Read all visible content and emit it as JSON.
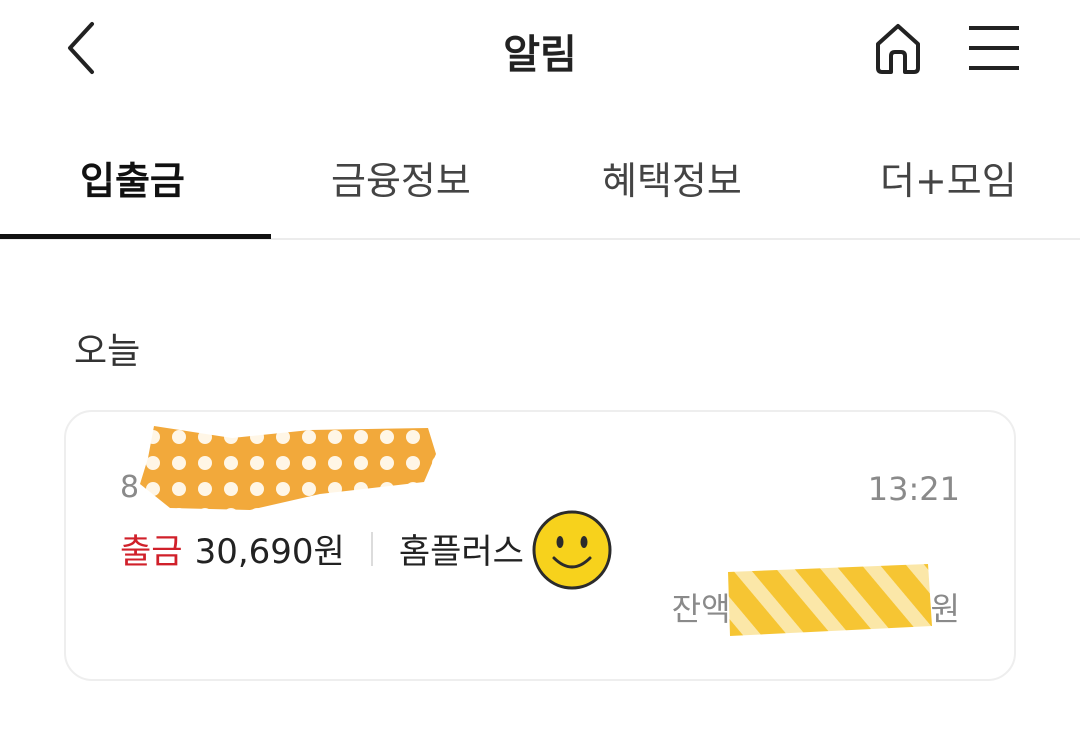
{
  "header": {
    "title": "알림",
    "back_icon": "chevron-left-icon",
    "home_icon": "home-icon",
    "menu_icon": "hamburger-menu-icon"
  },
  "tabs": [
    {
      "label": "입출금",
      "active": true
    },
    {
      "label": "금융정보",
      "active": false
    },
    {
      "label": "혜택정보",
      "active": false
    },
    {
      "label": "더+모임",
      "active": false
    }
  ],
  "section": {
    "label": "오늘"
  },
  "notification": {
    "account_visible": "8",
    "time": "13:21",
    "type": "출금",
    "amount": "30,690원",
    "merchant": "홈플러스",
    "balance_label": "잔액",
    "balance_suffix": "원"
  },
  "colors": {
    "accent_red": "#d0202a",
    "tab_indicator": "#111111",
    "tape_orange": "#f2a93b",
    "tape_yellow": "#f6c533",
    "smiley_yellow": "#f7d21c"
  }
}
